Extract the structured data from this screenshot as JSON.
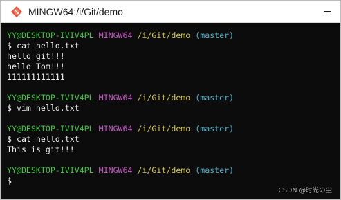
{
  "window": {
    "title": "MINGW64:/i/Git/demo"
  },
  "icons": {
    "app_icon": "git-diamond-icon",
    "minimize": "minimize-icon"
  },
  "colors": {
    "terminal_bg": "#0c0c0c",
    "user_host": "#3cc63c",
    "system": "#c45ac4",
    "path": "#d7c84a",
    "branch": "#4ab3c9",
    "text": "#f0f0f0"
  },
  "prompt": {
    "user_host": "YY@DESKTOP-IVIV4PL",
    "system": "MINGW64",
    "path": "/i/Git/demo",
    "branch": "(master)",
    "symbol": "$"
  },
  "session": {
    "block1": {
      "command": "$ cat hello.txt",
      "output": [
        "hello git!!!",
        "hello Tom!!!",
        "111111111111"
      ]
    },
    "block2": {
      "command": "$ vim hello.txt"
    },
    "block3": {
      "command": "$ cat hello.txt",
      "output": [
        "This is git!!!"
      ]
    },
    "block4": {
      "command": "$"
    }
  },
  "watermark": "CSDN @时光の尘"
}
